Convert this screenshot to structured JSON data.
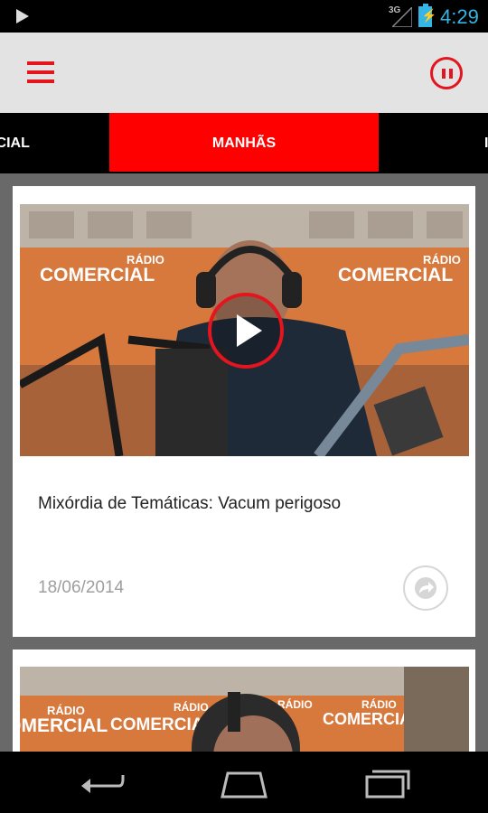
{
  "status_bar": {
    "network": "3G",
    "time": "4:29",
    "icons": [
      "play-icon",
      "signal-icon",
      "battery-charging-icon"
    ]
  },
  "app_bar": {
    "menu_icon": "hamburger-menu-icon",
    "pause_icon": "pause-circle-icon"
  },
  "tabs": [
    {
      "label": "RCIAL",
      "active": false
    },
    {
      "label": "MANHÃS",
      "active": true
    },
    {
      "label": "I",
      "active": false
    }
  ],
  "feed": {
    "items": [
      {
        "title": "Mixórdia de Temáticas: Vacum perigoso",
        "date": "18/06/2014",
        "thumbnail_logos": [
          "RÁDIO",
          "COMERCIAL"
        ],
        "play_icon": "play-circle-icon",
        "share_icon": "share-icon"
      },
      {
        "thumbnail_logos": [
          "RÁDIO",
          "COMERCIAL"
        ]
      }
    ]
  },
  "nav_bar": {
    "icons": [
      "back-icon",
      "home-icon",
      "recents-icon"
    ]
  },
  "colors": {
    "accent": "#e4151f",
    "tab_active": "#ff0000",
    "status_blue": "#33b5e5",
    "feed_bg": "#696969"
  }
}
